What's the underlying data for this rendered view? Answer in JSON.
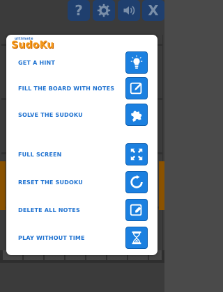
{
  "toolbar": {
    "help_icon": "?",
    "settings_icon": "gear-icon",
    "sound_icon": "speaker-icon",
    "close_icon": "X"
  },
  "logo": {
    "top": "ultimate",
    "main": "SudoKu"
  },
  "menu": [
    {
      "label": "GET A HINT",
      "icon": "lightbulb-icon"
    },
    {
      "label": "FILL THE BOARD WITH NOTES",
      "icon": "pencil-note-icon"
    },
    {
      "label": "SOLVE THE SUDOKU",
      "icon": "puzzle-piece-icon"
    },
    {
      "label": "FULL SCREEN",
      "icon": "fullscreen-icon"
    },
    {
      "label": "RESET THE SUDOKU",
      "icon": "reset-icon"
    },
    {
      "label": "DELETE ALL NOTES",
      "icon": "eraser-icon"
    },
    {
      "label": "PLAY WITHOUT TIME",
      "icon": "hourglass-icon"
    }
  ],
  "colors": {
    "accent": "#1b80e0",
    "label": "#1f72d0",
    "logo": "#f59a1b"
  }
}
